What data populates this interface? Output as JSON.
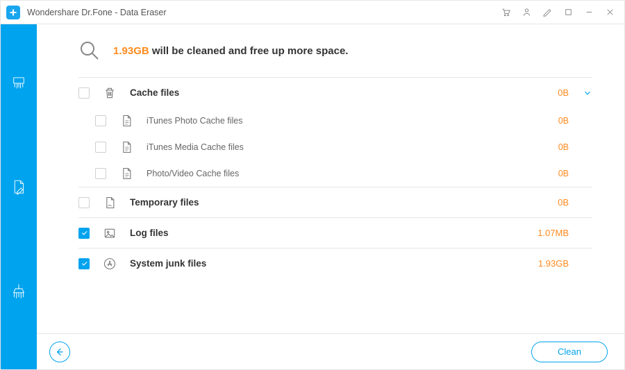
{
  "window": {
    "title": "Wondershare Dr.Fone - Data Eraser"
  },
  "summary": {
    "highlight_size": "1.93GB",
    "suffix_text": " will be cleaned and free up more space."
  },
  "categories": [
    {
      "id": "cache",
      "label": "Cache files",
      "size": "0B",
      "checked": false,
      "expanded": true,
      "icon": "trash-icon",
      "items": [
        {
          "label": "iTunes Photo Cache files",
          "size": "0B",
          "checked": false
        },
        {
          "label": "iTunes Media Cache files",
          "size": "0B",
          "checked": false
        },
        {
          "label": "Photo/Video Cache files",
          "size": "0B",
          "checked": false
        }
      ]
    },
    {
      "id": "temp",
      "label": "Temporary files",
      "size": "0B",
      "checked": false,
      "expanded": false,
      "icon": "file-icon",
      "items": []
    },
    {
      "id": "log",
      "label": "Log files",
      "size": "1.07MB",
      "checked": true,
      "expanded": false,
      "icon": "image-icon",
      "items": []
    },
    {
      "id": "sysjunk",
      "label": "System junk files",
      "size": "1.93GB",
      "checked": true,
      "expanded": false,
      "icon": "appstore-icon",
      "items": []
    }
  ],
  "footer": {
    "clean_label": "Clean"
  }
}
